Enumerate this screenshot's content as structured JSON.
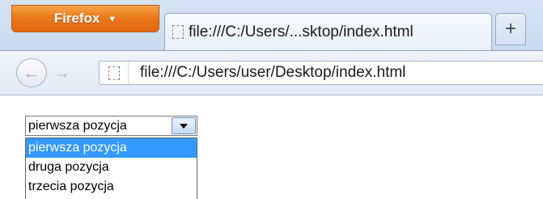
{
  "browser": {
    "menu_button_label": "Firefox",
    "menu_button_arrow": "▼",
    "tab_title": "file:///C:/Users/...sktop/index.html",
    "new_tab_label": "+",
    "back_glyph": "←",
    "forward_glyph": "→",
    "url": "file:///C:/Users/user/Desktop/index.html"
  },
  "select": {
    "selected_value": "pierwsza pozycja",
    "options": [
      {
        "label": "pierwsza pozycja",
        "highlighted": true
      },
      {
        "label": "druga pozycja",
        "highlighted": false
      },
      {
        "label": "trzecia pozycja",
        "highlighted": false
      }
    ]
  },
  "colors": {
    "menu_button": "#ec7a1b",
    "highlight": "#3399ff",
    "chrome": "#c9dbef"
  }
}
